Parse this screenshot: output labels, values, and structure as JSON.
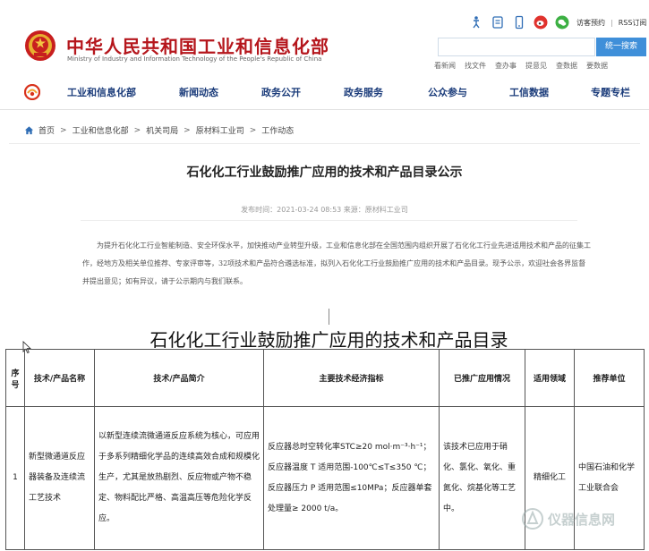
{
  "header": {
    "title": "中华人民共和国工业和信息化部",
    "subtitle": "Ministry of Industry and Information Technology of the People's Republic of China",
    "utility": {
      "visit_link": "访客预约",
      "rss_link": "RSS订阅",
      "separator": "|"
    },
    "search": {
      "placeholder": "",
      "button_label": "统一搜索"
    },
    "quick_links": [
      "看新闻",
      "找文件",
      "查办事",
      "提意见",
      "查数据",
      "要数据"
    ]
  },
  "nav": {
    "items": [
      "工业和信息化部",
      "新闻动态",
      "政务公开",
      "政务服务",
      "公众参与",
      "工信数据",
      "专题专栏"
    ]
  },
  "breadcrumb": {
    "items": [
      "首页",
      "工业和信息化部",
      "机关司局",
      "原材料工业司",
      "工作动态"
    ],
    "separator": ">"
  },
  "article": {
    "title": "石化化工行业鼓励推广应用的技术和产品目录公示",
    "meta": "发布时间：2021-03-24 08:53  来源：原材料工业司",
    "intro": "为提升石化化工行业智能制造、安全环保水平，加快推动产业转型升级，工业和信息化部在全国范围内组织开展了石化化工行业先进适用技术和产品的征集工作，经地方及相关单位推荐、专家评审等，32项技术和产品符合遴选标准，拟列入石化化工行业鼓励推广应用的技术和产品目录。现予公示，欢迎社会各界监督并提出意见；如有异议，请于公示期内与我们联系。"
  },
  "catalog": {
    "title": "石化化工行业鼓励推广应用的技术和产品目录",
    "headers": [
      "序号",
      "技术/产品名称",
      "技术/产品简介",
      "主要技术经济指标",
      "已推广应用情况",
      "适用领域",
      "推荐单位"
    ],
    "rows": [
      {
        "no": "1",
        "name": "新型微通道反应器装备及连续流工艺技术",
        "intro": "以新型连续流微通道反应系统为核心，可应用于多系列精细化学品的连续高效合成和规模化生产，尤其是放热剧烈、反应物或产物不稳定、物料配比严格、高温高压等危险化学反应。",
        "indicators": "反应器总时空转化率STC≥20 mol·m⁻³·h⁻¹；反应器温度 T 适用范围-100℃≤T≤350 ℃；反应器压力 P 适用范围≤10MPa；反应器单套处理量≥ 2000 t/a。",
        "application": "该技术已应用于硝化、氯化、氧化、重氮化、烷基化等工艺中。",
        "field": "精细化工",
        "recommender": "中国石油和化学工业联合会"
      }
    ]
  },
  "watermark": {
    "text": "仪器信息网"
  },
  "colors": {
    "brand_red": "#b5161c",
    "nav_blue": "#1a3b7a",
    "search_blue": "#3f8fd9"
  }
}
